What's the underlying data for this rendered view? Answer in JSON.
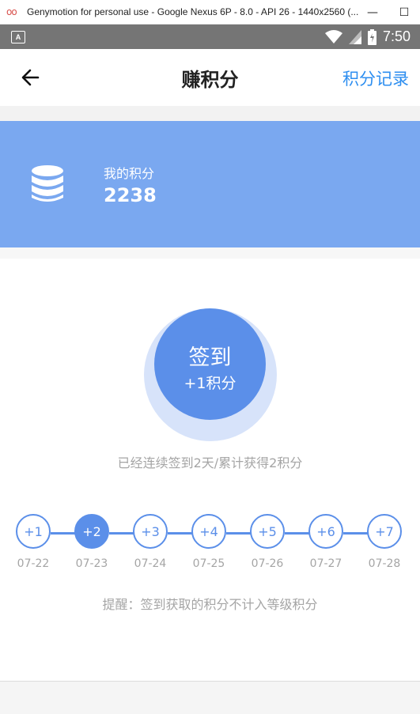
{
  "window": {
    "logo": "oo",
    "title": "Genymotion for personal use - Google Nexus 6P - 8.0 - API 26 - 1440x2560 (...",
    "minimize": "—",
    "maximize": "☐"
  },
  "statusbar": {
    "notification": "A",
    "time": "7:50"
  },
  "header": {
    "title": "赚积分",
    "records_link": "积分记录"
  },
  "banner": {
    "label": "我的积分",
    "points": "2238"
  },
  "checkin": {
    "title": "签到",
    "subtitle": "+1积分"
  },
  "streak_text": "已经连续签到2天/累计获得2积分",
  "days": [
    {
      "reward": "+1",
      "date": "07-22",
      "active": false
    },
    {
      "reward": "+2",
      "date": "07-23",
      "active": true
    },
    {
      "reward": "+3",
      "date": "07-24",
      "active": false
    },
    {
      "reward": "+4",
      "date": "07-25",
      "active": false
    },
    {
      "reward": "+5",
      "date": "07-26",
      "active": false
    },
    {
      "reward": "+6",
      "date": "07-27",
      "active": false
    },
    {
      "reward": "+7",
      "date": "07-28",
      "active": false
    }
  ],
  "tip": "提醒：签到获取的积分不计入等级积分",
  "colors": {
    "accent": "#5b8fe9",
    "banner": "#7aa8f0",
    "link": "#2d8ef0",
    "muted_text": "#a5a5a5"
  }
}
